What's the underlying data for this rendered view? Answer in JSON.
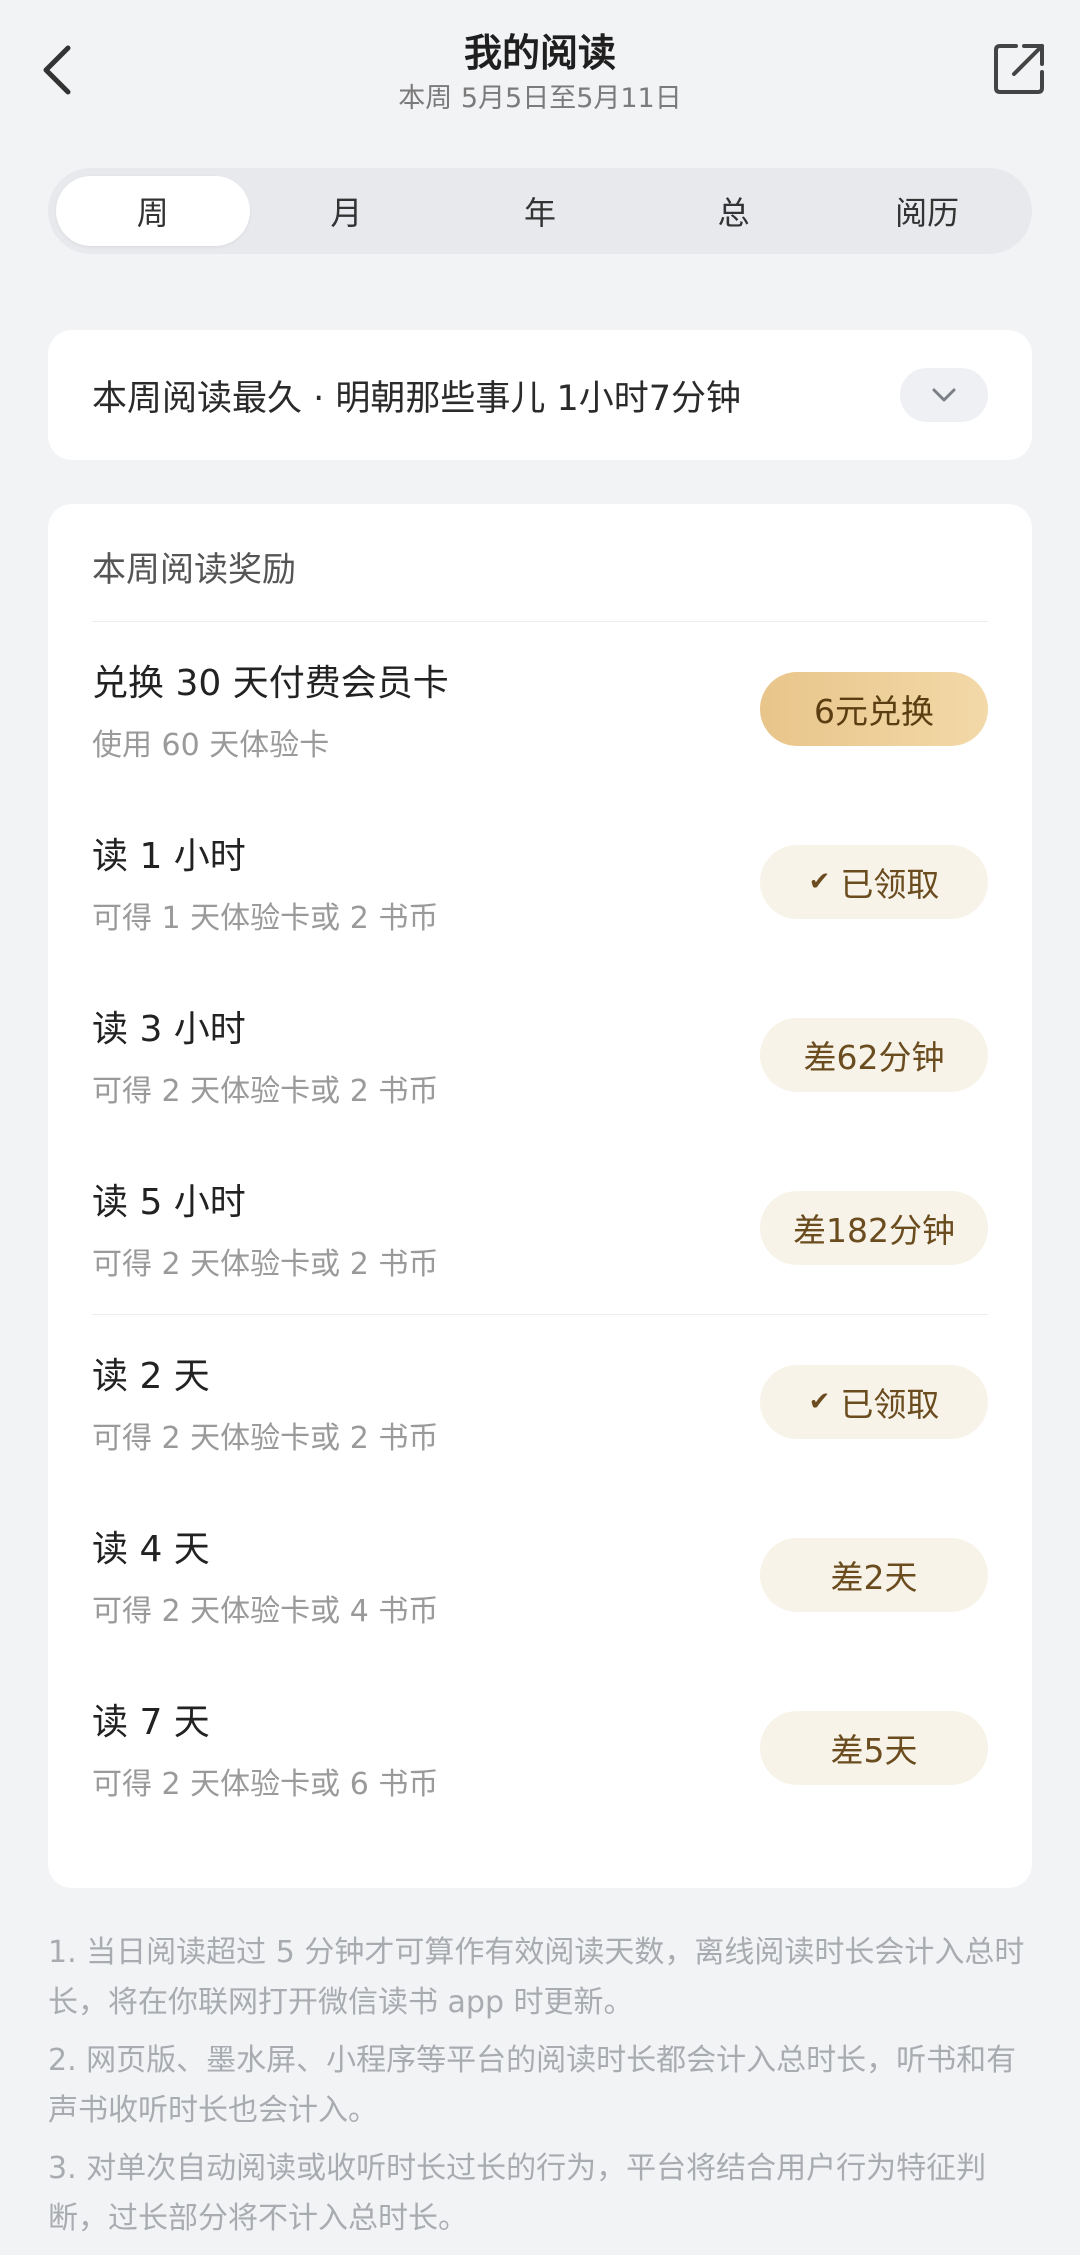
{
  "header": {
    "title": "我的阅读",
    "subtitle": "本周 5月5日至5月11日"
  },
  "tabs": [
    {
      "label": "周",
      "active": true
    },
    {
      "label": "月",
      "active": false
    },
    {
      "label": "年",
      "active": false
    },
    {
      "label": "总",
      "active": false
    },
    {
      "label": "阅历",
      "active": false
    }
  ],
  "most_read": {
    "text": "本周阅读最久 · 明朝那些事儿 1小时7分钟"
  },
  "rewards": {
    "title": "本周阅读奖励",
    "items": [
      {
        "title": "兑换 30 天付费会员卡",
        "sub": "使用 60 天体验卡",
        "button": "6元兑换"
      },
      {
        "title": "读 1 小时",
        "sub": "可得 1 天体验卡或 2 书币",
        "button": "已领取"
      },
      {
        "title": "读 3 小时",
        "sub": "可得 2 天体验卡或 2 书币",
        "button": "差62分钟"
      },
      {
        "title": "读 5 小时",
        "sub": "可得 2 天体验卡或 2 书币",
        "button": "差182分钟"
      },
      {
        "title": "读 2 天",
        "sub": "可得 2 天体验卡或 2 书币",
        "button": "已领取"
      },
      {
        "title": "读 4 天",
        "sub": "可得 2 天体验卡或 4 书币",
        "button": "差2天"
      },
      {
        "title": "读 7 天",
        "sub": "可得 2 天体验卡或 6 书币",
        "button": "差5天"
      }
    ]
  },
  "notes": [
    "1. 当日阅读超过 5 分钟才可算作有效阅读天数，离线阅读时长会计入总时长，将在你联网打开微信读书 app 时更新。",
    "2. 网页版、墨水屏、小程序等平台的阅读时长都会计入总时长，听书和有声书收听时长也会计入。",
    "3. 对单次自动阅读或收听时长过长的行为，平台将结合用户行为特征判断，过长部分将不计入总时长。"
  ],
  "icons": {
    "back": "chevron-left-icon",
    "share": "share-icon",
    "expand": "chevron-down-icon",
    "claimed": "check-icon"
  },
  "colors": {
    "background": "#f2f3f5",
    "card": "#ffffff",
    "accent_gold": "#e8c58a",
    "pill_bg": "#f8f3e8",
    "pill_text": "#6a4c1f"
  }
}
